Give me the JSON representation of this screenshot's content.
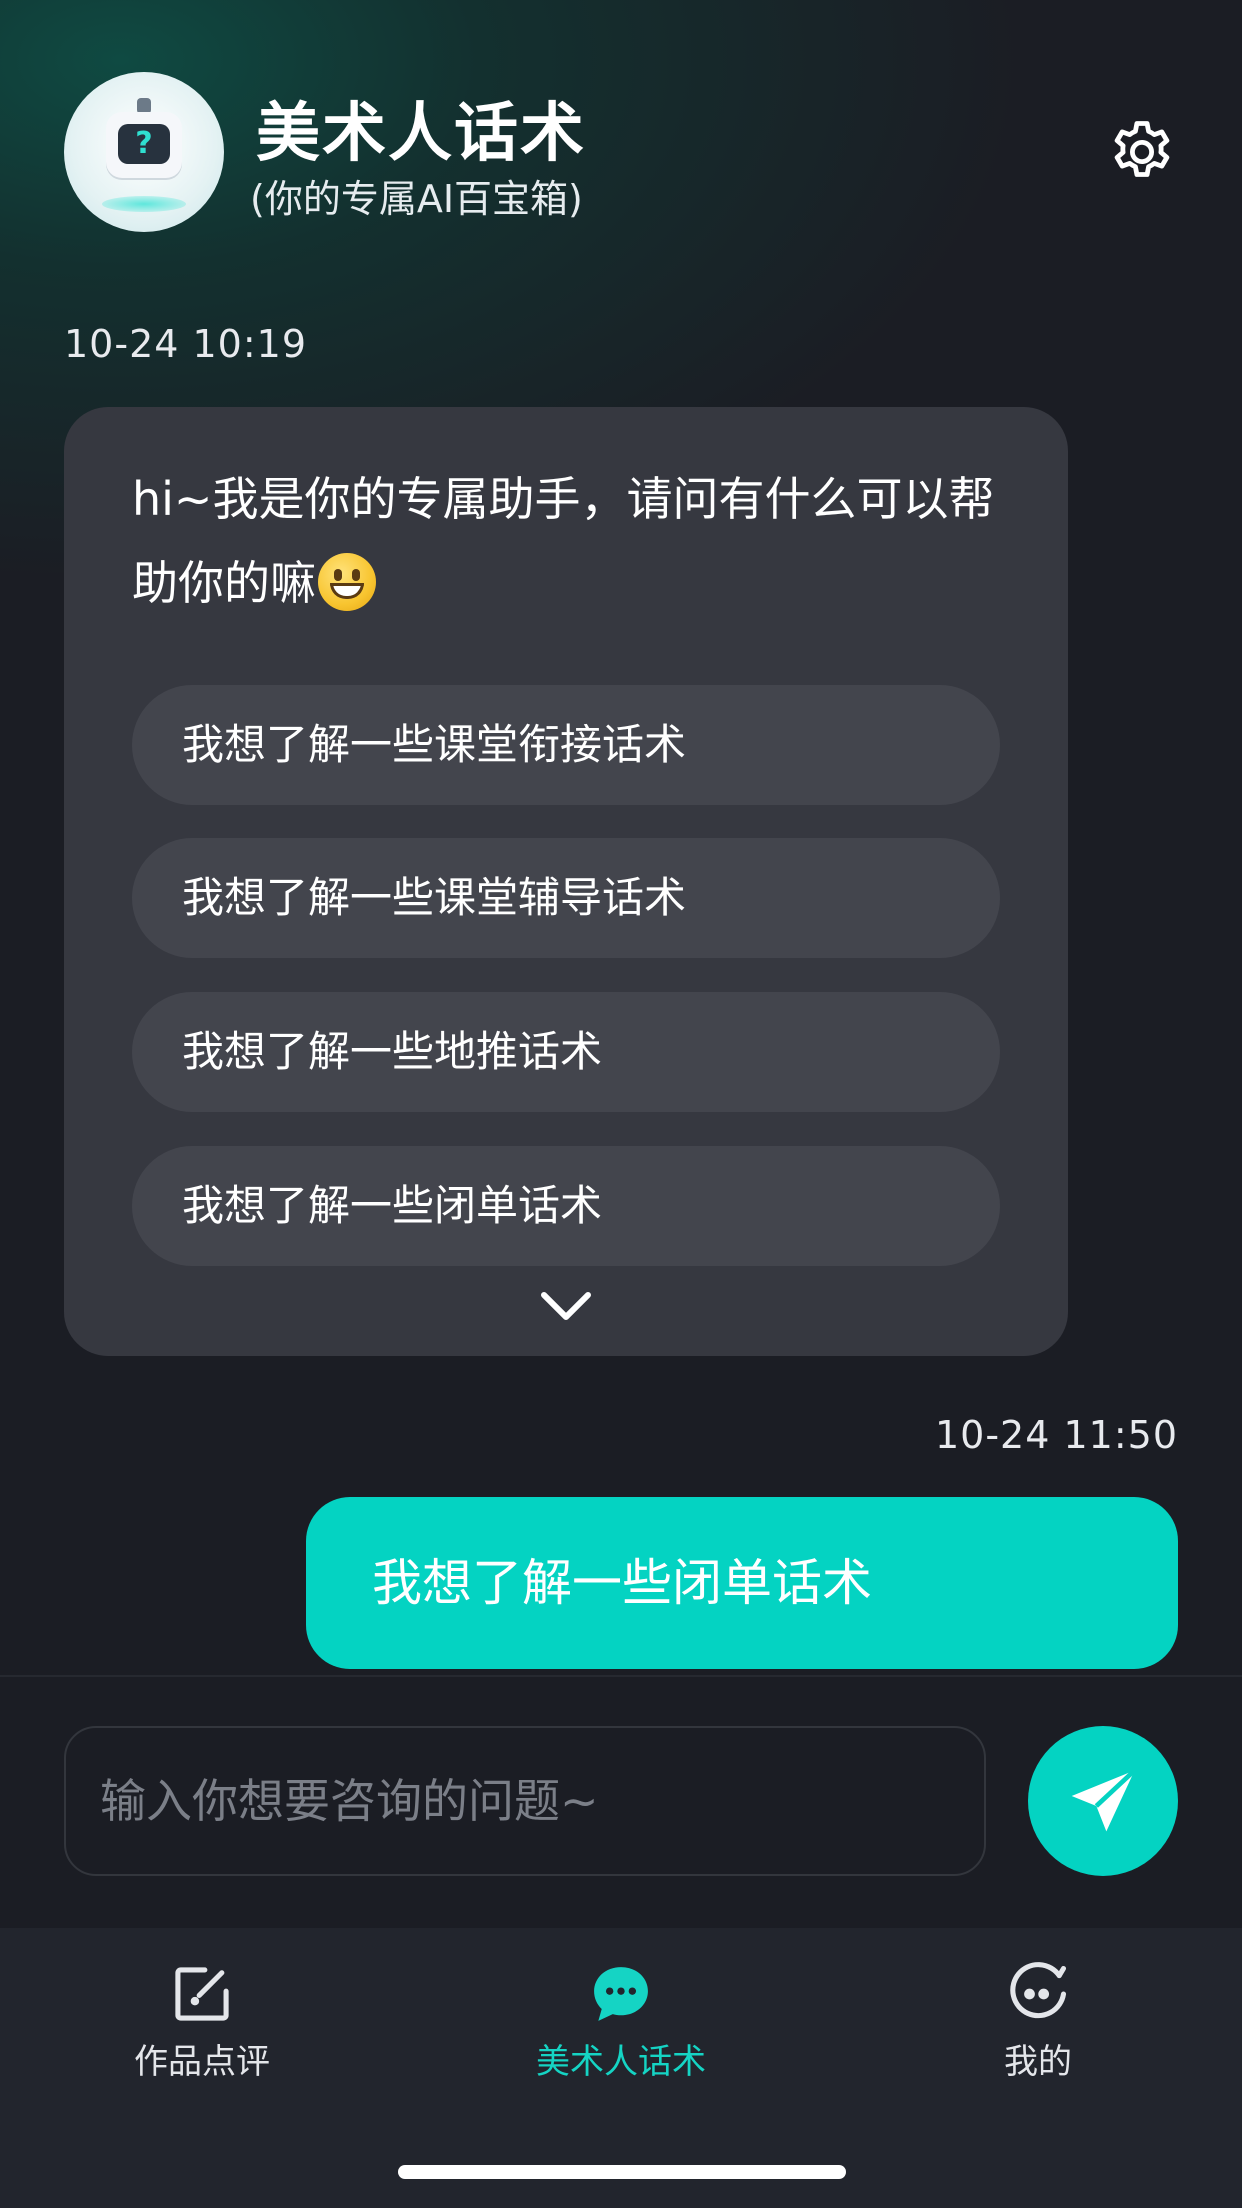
{
  "header": {
    "title": "美术人话术",
    "subtitle": "(你的专属AI百宝箱)"
  },
  "chat": {
    "bot_message": {
      "timestamp": "10-24 10:19",
      "text": "hi~我是你的专属助手，请问有什么可以帮助你的嘛",
      "emoji": "grinning-face-emoji",
      "suggestions": [
        "我想了解一些课堂衔接话术",
        "我想了解一些课堂辅导话术",
        "我想了解一些地推话术",
        "我想了解一些闭单话术"
      ]
    },
    "user_message": {
      "timestamp": "10-24 11:50",
      "text": "我想了解一些闭单话术"
    }
  },
  "composer": {
    "placeholder": "输入你想要咨询的问题~",
    "send_icon": "send-icon"
  },
  "tabbar": {
    "tabs": [
      {
        "label": "作品点评",
        "icon": "edit-icon",
        "active": false
      },
      {
        "label": "美术人话术",
        "icon": "chat-bubble-icon",
        "active": true
      },
      {
        "label": "我的",
        "icon": "profile-face-icon",
        "active": false
      }
    ]
  },
  "colors": {
    "accent": "#04d3c2",
    "background": "#1b1d24",
    "bubble": "#363840",
    "suggestion": "#43454d"
  }
}
